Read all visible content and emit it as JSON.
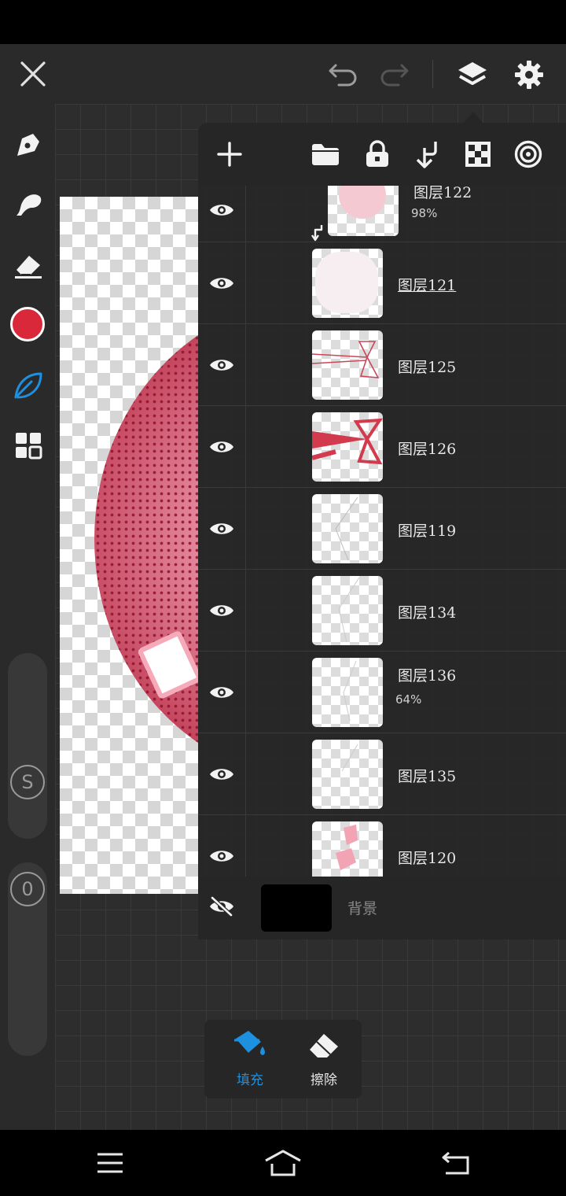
{
  "toolbar": {
    "close": "close-icon",
    "undo": "undo-icon",
    "redo": "redo-icon",
    "layers": "layers-icon",
    "settings": "gear-icon"
  },
  "left_tools": {
    "brush_color": "#d9283a",
    "accent": "#1e90e0",
    "size_label": "S",
    "opacity_label": "0"
  },
  "panel_toolbar": [
    "add-layer-icon",
    "folder-icon",
    "lock-icon",
    "merge-down-icon",
    "transparency-icon",
    "blend-icon"
  ],
  "layers": [
    {
      "name": "图层122",
      "opacity": "98%",
      "clipped": true
    },
    {
      "name": "图层121",
      "opacity": "",
      "clipped": false
    },
    {
      "name": "图层125",
      "opacity": "",
      "clipped": false
    },
    {
      "name": "图层126",
      "opacity": "",
      "clipped": false
    },
    {
      "name": "图层119",
      "opacity": "",
      "clipped": false
    },
    {
      "name": "图层134",
      "opacity": "",
      "clipped": false
    },
    {
      "name": "图层136",
      "opacity": "64%",
      "clipped": false
    },
    {
      "name": "图层135",
      "opacity": "",
      "clipped": false
    },
    {
      "name": "图层120",
      "opacity": "",
      "clipped": false
    }
  ],
  "background_layer": {
    "name": "背景",
    "color": "#000000"
  },
  "bottom_tools": {
    "fill_label": "填充",
    "erase_label": "擦除"
  }
}
